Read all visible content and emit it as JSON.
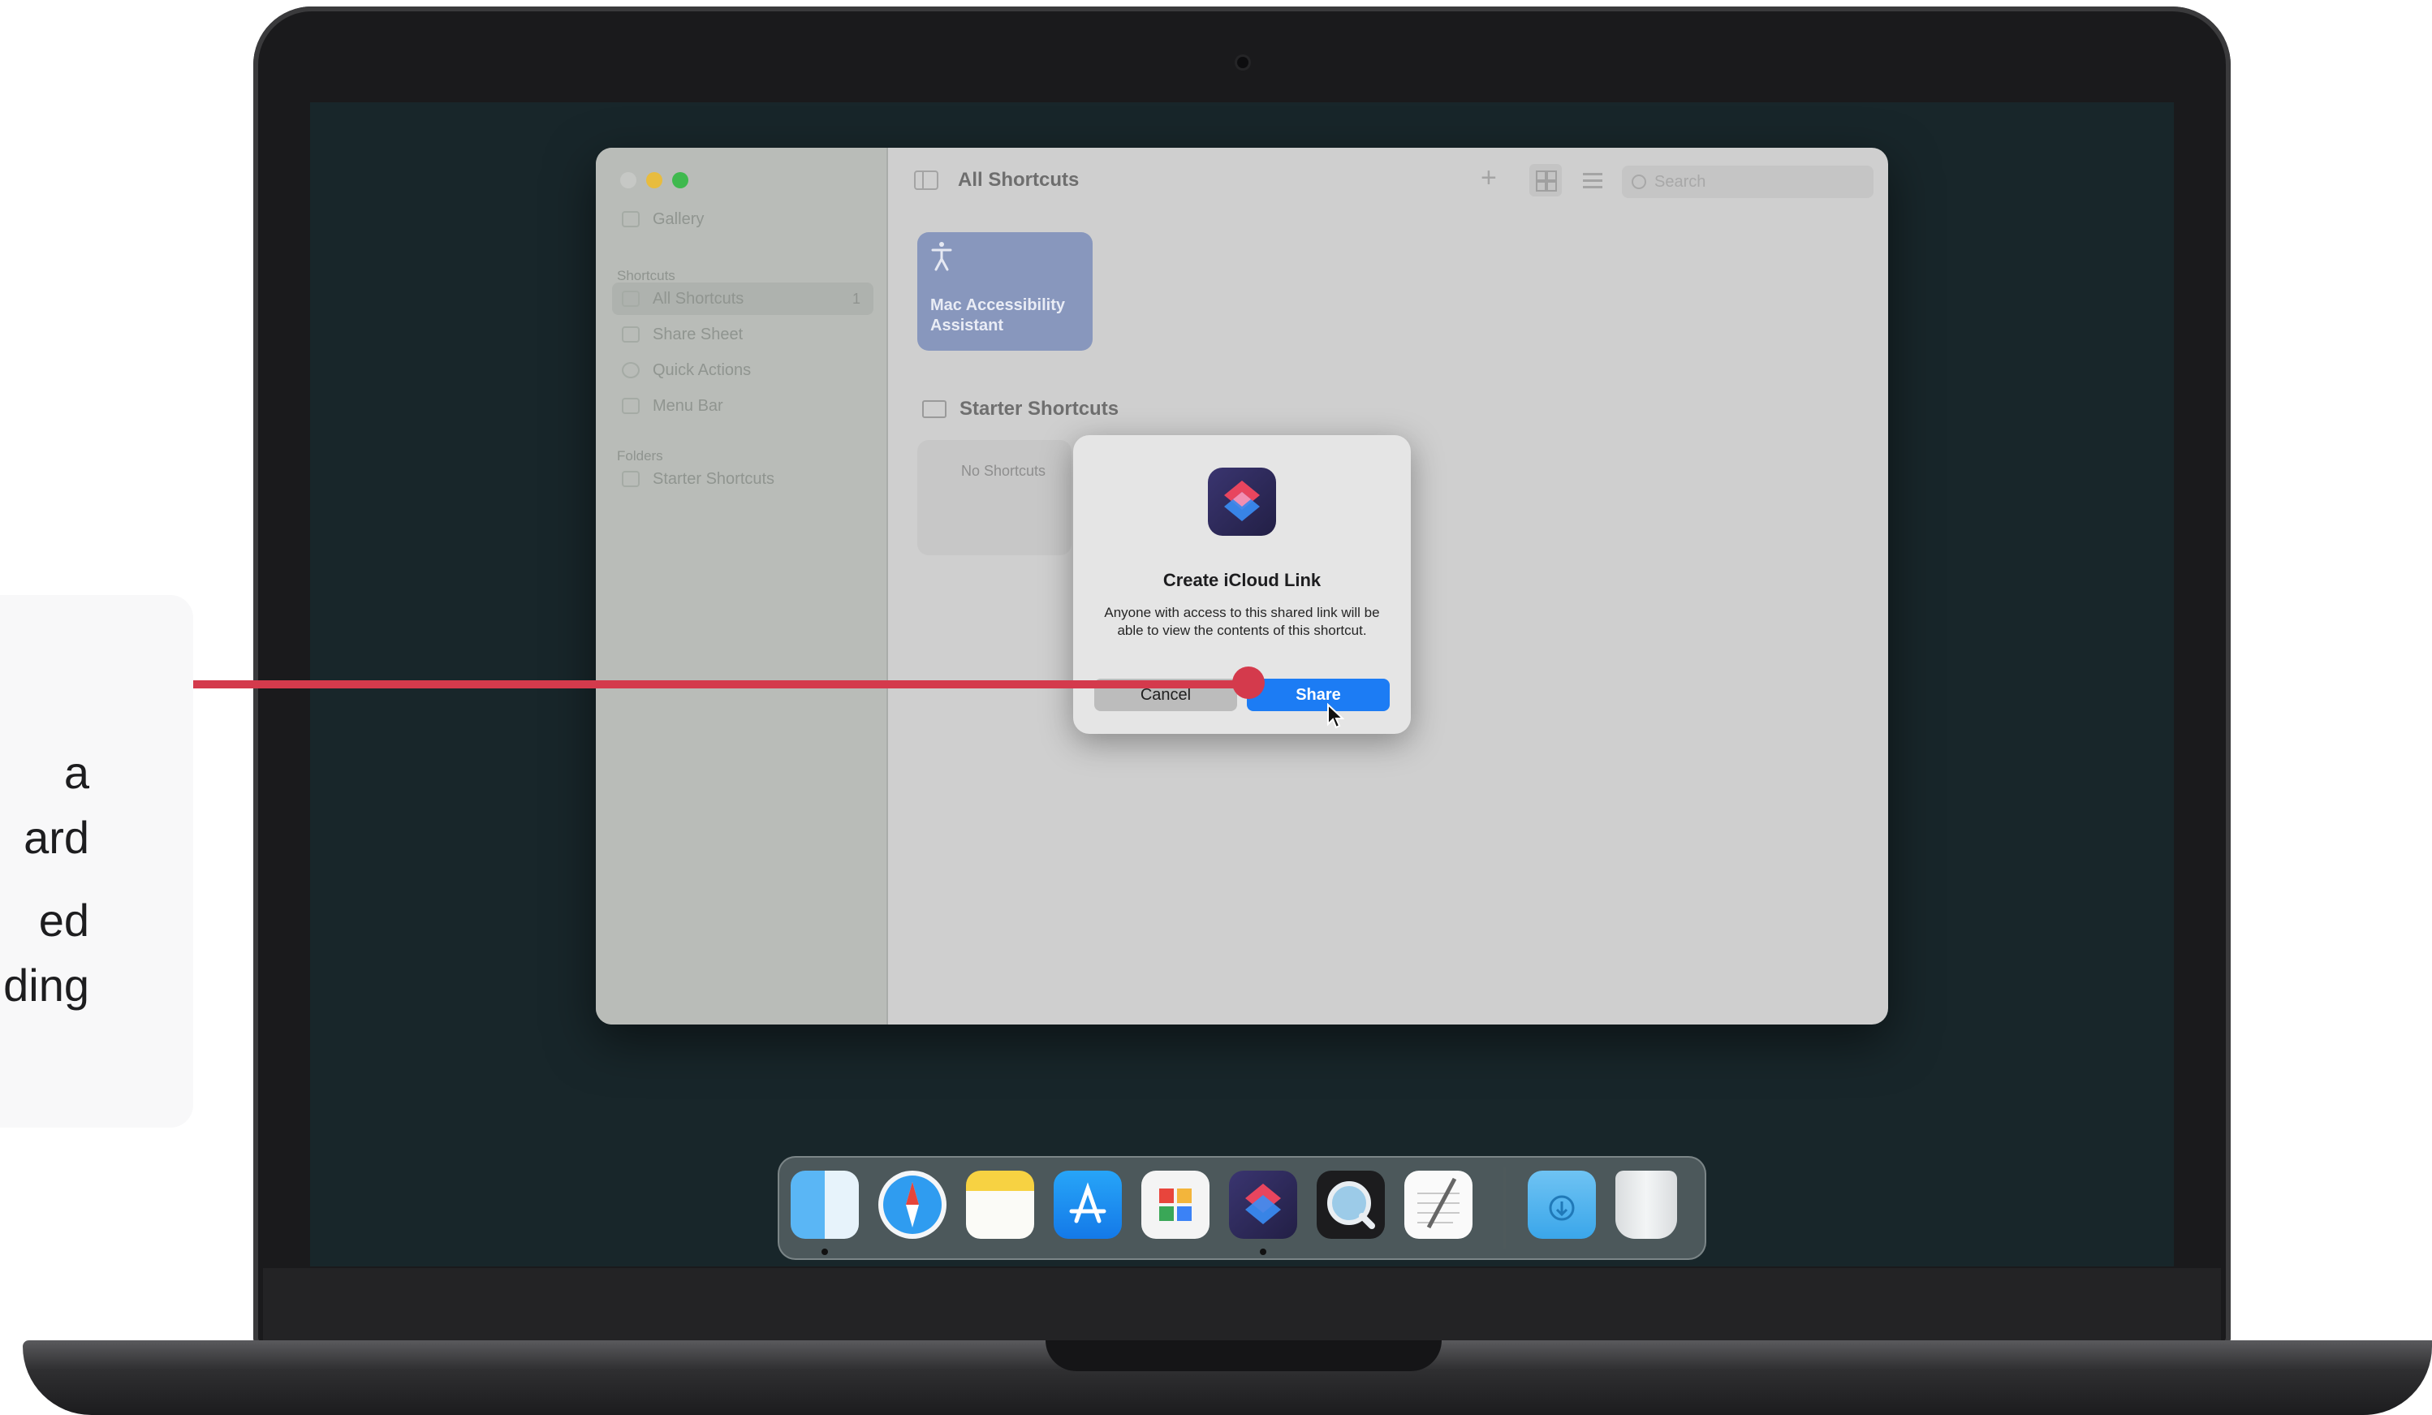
{
  "callout": {
    "line1": "a",
    "line2": "ard",
    "line3": "ed",
    "line4": "ding"
  },
  "window": {
    "title": "All Shortcuts",
    "search_placeholder": "Search",
    "sidebar": {
      "gallery": "Gallery",
      "shortcuts_section": "Shortcuts",
      "items": [
        {
          "label": "All Shortcuts",
          "count": "1"
        },
        {
          "label": "Share Sheet"
        },
        {
          "label": "Quick Actions"
        },
        {
          "label": "Menu Bar"
        }
      ],
      "folders_section": "Folders",
      "folders": [
        {
          "label": "Starter Shortcuts"
        }
      ]
    },
    "tile": {
      "label_line1": "Mac Accessibility",
      "label_line2": "Assistant",
      "color": "#8897bd"
    },
    "folder_heading": "Starter Shortcuts",
    "empty_text": "No Shortcuts"
  },
  "dialog": {
    "title": "Create iCloud Link",
    "body": "Anyone with access to this shared link will be able to view the contents of this shortcut.",
    "cancel_label": "Cancel",
    "share_label": "Share",
    "accent": "#1c7cf4"
  },
  "dock": {
    "apps": [
      "finder-icon",
      "safari-icon",
      "notes-icon",
      "app-store-icon",
      "keynote-icon",
      "shortcuts-icon",
      "quicktime-icon",
      "textedit-icon",
      "downloads-folder-icon",
      "trash-icon"
    ]
  },
  "colors": {
    "connector": "#d43a4c",
    "screen_background": "#18262a"
  }
}
